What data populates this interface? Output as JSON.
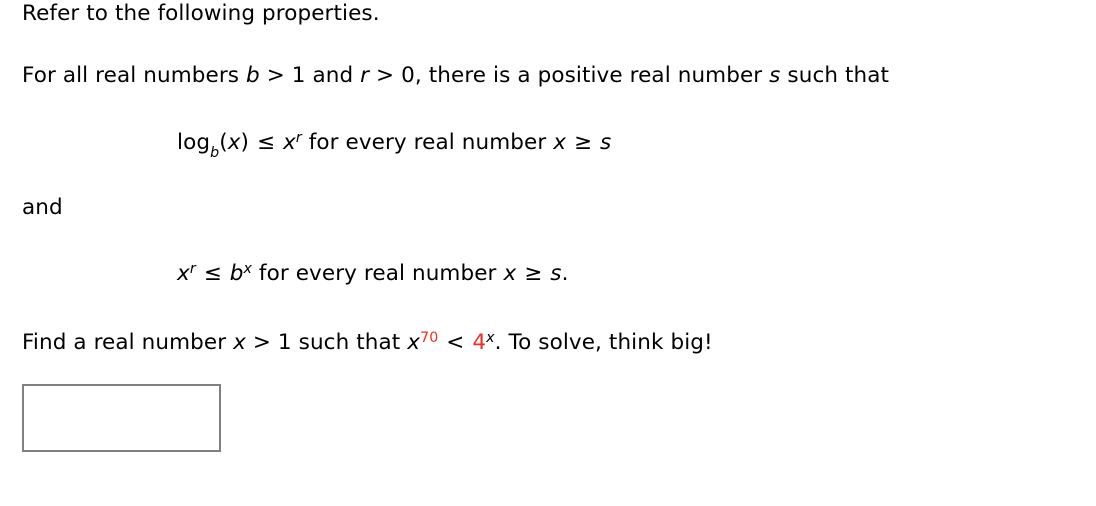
{
  "problem": {
    "intro": "Refer to the following properties.",
    "premise": {
      "prefix": "For all real numbers ",
      "var_b": "b",
      "rel_b": " > 1 and ",
      "var_r": "r",
      "rel_r": " > 0, there is a positive real number ",
      "var_s": "s",
      "suffix": " such that"
    },
    "property_1": {
      "log_name": "log",
      "log_base": "b",
      "log_arg_open": "(",
      "log_arg": "x",
      "log_arg_close": ")",
      "relation": " ≤ ",
      "rhs_base": "x",
      "rhs_exp": "r",
      "tail_text": " for every real number ",
      "tail_var": "x",
      "tail_relation": " ≥ ",
      "tail_bound": "s"
    },
    "conjunction": "and",
    "property_2": {
      "lhs_base": "x",
      "lhs_exp": "r",
      "relation": " ≤ ",
      "rhs_base": "b",
      "rhs_exp": "x",
      "tail_text": " for every real number ",
      "tail_var": "x",
      "tail_relation": " ≥ ",
      "tail_bound": "s",
      "tail_period": "."
    },
    "question": {
      "prefix": "Find a real number ",
      "var_x": "x",
      "condition": " > 1 such that ",
      "expr_lhs_base": "x",
      "expr_lhs_exp": "70",
      "expr_relation": " < ",
      "expr_rhs_base": "4",
      "expr_rhs_exp": "x",
      "period": ".",
      "hint": " To solve, think big!"
    }
  },
  "answer_field": {
    "value": "",
    "placeholder": ""
  },
  "colors": {
    "text": "#000000",
    "highlight": "#ee2f24",
    "input_border": "#808080",
    "background": "#ffffff"
  }
}
